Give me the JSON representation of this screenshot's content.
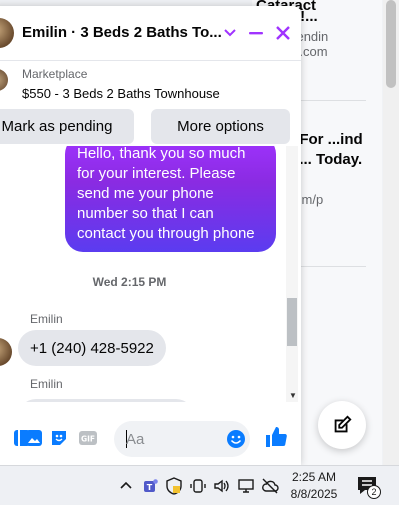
{
  "background_page": {
    "article1_title_line1": "Cataract",
    "article1_title_line2": "...pear!...",
    "article1_source_line1": "...ear.trendin",
    "article1_source_line2": "...adget.com",
    "article2_title": "...obs For ...ind Great ... Today.",
    "article2_source_line1": "...iter.com/p",
    "article2_source_line2": "...b"
  },
  "chat": {
    "header_title": "Emilin · 3 Beds 2 Baths To...",
    "listing_label": "Marketplace",
    "listing_title": "$550 - 3 Beds 2 Baths Townhouse",
    "mark_pending_label": "Mark as pending",
    "more_options_label": "More options",
    "outgoing_message": "Hello, thank you so much for your interest. Please send me your phone number so that I can contact you through phone",
    "timestamp": "Wed 2:15 PM",
    "sender_name_1": "Emilin",
    "incoming_message_1": "+1 (240) 428-5922",
    "sender_name_2": "Emilin",
    "input_placeholder": "Aa"
  },
  "colors": {
    "accent": "#a033ff",
    "bubble_gradient_start": "#a033ff",
    "bubble_gradient_end": "#5b3cf0",
    "messenger_blue": "#0a7cff",
    "incoming_bubble": "#e4e6eb"
  },
  "taskbar": {
    "time": "2:25 AM",
    "date": "8/8/2025",
    "notification_count": "2"
  }
}
